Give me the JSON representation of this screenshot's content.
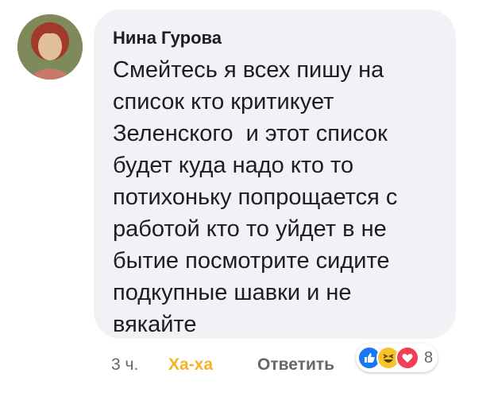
{
  "comment": {
    "author": "Нина Гурова",
    "text": "Смейтесь я всех пишу на\nсписок кто критикует\nЗеленского  и этот список\nбудет куда надо кто то\nпотихоньку попрощается с\nработой кто то уйдет в не\nбытие посмотрите сидите\nподкупные шавки и не\nвякайте"
  },
  "actions": {
    "time": "3 ч.",
    "reaction_label": "Ха-ха",
    "reply_label": "Ответить"
  },
  "reactions": {
    "icons": [
      "like-icon",
      "haha-icon",
      "love-icon"
    ],
    "count": "8",
    "colors": {
      "like": "#1877f2",
      "haha": "#f7c32b",
      "love": "#f33e58",
      "haha_label": "#f7b125"
    }
  }
}
